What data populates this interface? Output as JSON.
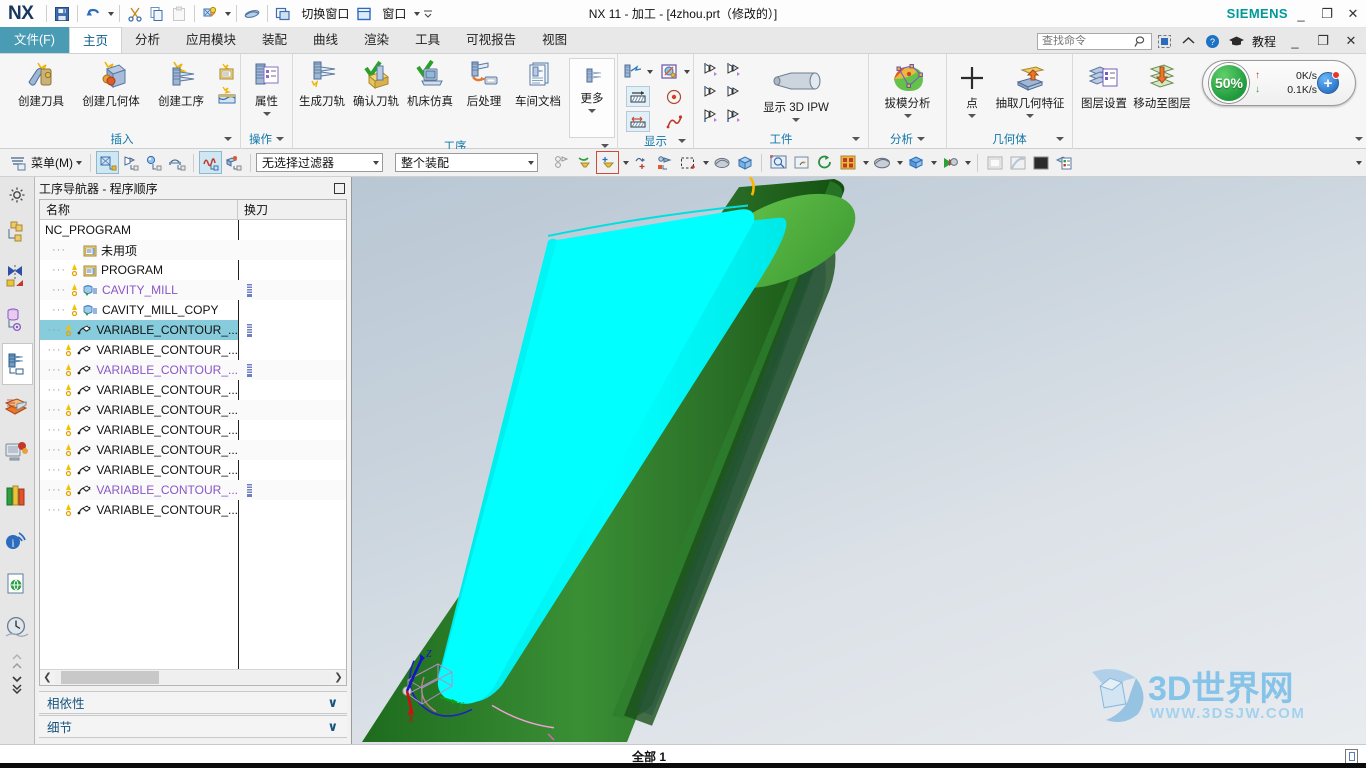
{
  "titlebar": {
    "logo": "NX",
    "title": "NX 11 - 加工 - [4zhou.prt（修改的）]",
    "brand": "SIEMENS",
    "quick_access": [
      {
        "name": "save",
        "label": "保存"
      },
      {
        "name": "undo",
        "label": "撤销"
      },
      {
        "name": "cut",
        "label": "剪切"
      },
      {
        "name": "copy",
        "label": "复制"
      },
      {
        "name": "paste",
        "label": "粘贴"
      },
      {
        "name": "redisplay",
        "label": "重新显示"
      },
      {
        "name": "undo-edit",
        "label": "取消"
      }
    ],
    "switch_window_label": "切换窗口",
    "window_label": "窗口",
    "minimize": "_",
    "restore": "❐",
    "close": "✕"
  },
  "tabs": [
    {
      "label": "文件(F)",
      "active": false,
      "file": true
    },
    {
      "label": "主页",
      "active": true
    },
    {
      "label": "分析",
      "active": false
    },
    {
      "label": "应用模块",
      "active": false
    },
    {
      "label": "装配",
      "active": false
    },
    {
      "label": "曲线",
      "active": false
    },
    {
      "label": "渲染",
      "active": false
    },
    {
      "label": "工具",
      "active": false
    },
    {
      "label": "可视报告",
      "active": false
    },
    {
      "label": "视图",
      "active": false
    }
  ],
  "tab_right": {
    "search_placeholder": "查找命令",
    "tutorial_label": "教程",
    "minimize": "_",
    "restore": "❐",
    "close": "✕"
  },
  "ribbon": {
    "groups": [
      {
        "name": "插入",
        "big": [
          {
            "label": "创建刀具",
            "icon": "create-tool-icon"
          },
          {
            "label": "创建几何体",
            "icon": "create-geometry-icon"
          },
          {
            "label": "创建工序",
            "icon": "create-operation-icon"
          }
        ],
        "small": [
          {
            "icon": "create-program-icon"
          },
          {
            "icon": "create-method-icon"
          }
        ]
      },
      {
        "name": "操作",
        "big": [
          {
            "label": "属性",
            "icon": "properties-icon",
            "dropdown": true
          }
        ]
      },
      {
        "name": "工序",
        "big": [
          {
            "label": "生成刀轨",
            "icon": "generate-toolpath-icon"
          },
          {
            "label": "确认刀轨",
            "icon": "verify-toolpath-icon"
          },
          {
            "label": "机床仿真",
            "icon": "machine-simulation-icon"
          },
          {
            "label": "后处理",
            "icon": "postprocess-icon"
          },
          {
            "label": "车间文档",
            "icon": "shop-documentation-icon"
          },
          {
            "label": "更多",
            "icon": "more-icon",
            "dropdown": true
          }
        ]
      },
      {
        "name": "显示",
        "small": [
          {
            "icon": "display-toolpath-icon",
            "dropdown": true
          },
          {
            "icon": "display-ipw-icon",
            "dropdown": true
          },
          {
            "icon": "cut-region-icon",
            "selected": true
          },
          {
            "icon": "point-display-icon"
          },
          {
            "icon": "cut-area-icon",
            "selected": true
          },
          {
            "icon": "curve-icon"
          }
        ]
      },
      {
        "name": "工件",
        "small": [
          {
            "icon": "workpiece-1-icon"
          },
          {
            "icon": "workpiece-2-icon"
          },
          {
            "icon": "workpiece-3-icon"
          },
          {
            "icon": "workpiece-4-icon"
          },
          {
            "icon": "workpiece-5-icon"
          },
          {
            "icon": "workpiece-6-icon"
          }
        ],
        "big": [
          {
            "label": "显示 3D IPW",
            "icon": "show-3d-ipw-icon",
            "dropdown": true
          }
        ]
      },
      {
        "name": "分析",
        "big": [
          {
            "label": "拔模分析",
            "icon": "draft-analysis-icon",
            "dropdown": true
          }
        ]
      },
      {
        "name": "几何体",
        "big": [
          {
            "label": "点",
            "icon": "point-icon",
            "dropdown": true
          },
          {
            "label": "抽取几何特征",
            "icon": "extract-geometry-icon",
            "dropdown": true
          }
        ]
      },
      {
        "name": "",
        "big": [
          {
            "label": "图层设置",
            "icon": "layer-settings-icon"
          },
          {
            "label": "移动至图层",
            "icon": "move-to-layer-icon"
          }
        ]
      }
    ]
  },
  "network_widget": {
    "percent": "50%",
    "up_rate": "0K/s",
    "down_rate": "0.1K/s",
    "up_arrow": "↑",
    "down_arrow": "↓",
    "badge": "+"
  },
  "toolbar2": {
    "menu_label": "菜单(M)",
    "selection_filter": "无选择过滤器",
    "assembly_scope": "整个装配",
    "buttons": [
      {
        "name": "select-face-icon",
        "selected": true
      },
      {
        "name": "select-edge-icon"
      },
      {
        "name": "select-body-icon"
      },
      {
        "name": "select-feature-icon"
      },
      {
        "name": "select-curve-icon",
        "selected": true
      },
      {
        "name": "select-component-icon"
      }
    ],
    "right_buttons": [
      {
        "name": "fit-view-icon"
      },
      {
        "name": "zoom-window-icon"
      },
      {
        "name": "pan-icon"
      },
      {
        "name": "rotate-icon"
      },
      {
        "name": "view-orientation-icon"
      },
      {
        "name": "shading-icon"
      },
      {
        "name": "render-style-icon"
      },
      {
        "name": "background-icon"
      },
      {
        "name": "layout-1-icon"
      },
      {
        "name": "layout-2-icon"
      },
      {
        "name": "layout-3-icon"
      },
      {
        "name": "layer-visible-icon"
      }
    ]
  },
  "resource_bar": [
    {
      "name": "assembly-navigator-icon",
      "active": false
    },
    {
      "name": "constraint-navigator-icon",
      "active": false
    },
    {
      "name": "part-navigator-icon",
      "active": false
    },
    {
      "name": "operation-navigator-icon",
      "active": true
    },
    {
      "name": "reuse-library-icon",
      "active": false
    },
    {
      "name": "web-browser-icon",
      "active": false
    },
    {
      "name": "history-icon",
      "active": false
    },
    {
      "name": "info-icon",
      "active": false
    },
    {
      "name": "html-help-icon",
      "active": false
    },
    {
      "name": "roles-icon",
      "active": false
    }
  ],
  "navigator": {
    "title": "工序导航器 - 程序顺序",
    "columns": [
      "名称",
      "换刀"
    ],
    "rows": [
      {
        "label": "NC_PROGRAM",
        "indent": 0,
        "icon": "none",
        "color": "black",
        "warn": false,
        "tool": false,
        "selected": false
      },
      {
        "label": "未用项",
        "indent": 1,
        "icon": "folder",
        "color": "black",
        "warn": false,
        "tool": false,
        "selected": false
      },
      {
        "label": "PROGRAM",
        "indent": 1,
        "icon": "folder",
        "color": "black",
        "warn": true,
        "tool": false,
        "selected": false
      },
      {
        "label": "CAVITY_MILL",
        "indent": 1,
        "icon": "mill",
        "color": "purple",
        "warn": true,
        "tool": true,
        "selected": false
      },
      {
        "label": "CAVITY_MILL_COPY",
        "indent": 1,
        "icon": "mill",
        "color": "black",
        "warn": true,
        "tool": false,
        "selected": false
      },
      {
        "label": "VARIABLE_CONTOUR_...",
        "indent": 1,
        "icon": "contour",
        "color": "black",
        "warn": true,
        "tool": true,
        "selected": true
      },
      {
        "label": "VARIABLE_CONTOUR_...",
        "indent": 1,
        "icon": "contour",
        "color": "black",
        "warn": true,
        "tool": false,
        "selected": false
      },
      {
        "label": "VARIABLE_CONTOUR_...",
        "indent": 1,
        "icon": "contour",
        "color": "purple",
        "warn": true,
        "tool": true,
        "selected": false
      },
      {
        "label": "VARIABLE_CONTOUR_...",
        "indent": 1,
        "icon": "contour",
        "color": "black",
        "warn": true,
        "tool": false,
        "selected": false
      },
      {
        "label": "VARIABLE_CONTOUR_...",
        "indent": 1,
        "icon": "contour",
        "color": "black",
        "warn": true,
        "tool": false,
        "selected": false
      },
      {
        "label": "VARIABLE_CONTOUR_...",
        "indent": 1,
        "icon": "contour",
        "color": "black",
        "warn": true,
        "tool": false,
        "selected": false
      },
      {
        "label": "VARIABLE_CONTOUR_...",
        "indent": 1,
        "icon": "contour",
        "color": "black",
        "warn": true,
        "tool": false,
        "selected": false
      },
      {
        "label": "VARIABLE_CONTOUR_...",
        "indent": 1,
        "icon": "contour",
        "color": "black",
        "warn": true,
        "tool": false,
        "selected": false
      },
      {
        "label": "VARIABLE_CONTOUR_...",
        "indent": 1,
        "icon": "contour",
        "color": "purple",
        "warn": true,
        "tool": true,
        "selected": false
      },
      {
        "label": "VARIABLE_CONTOUR_...",
        "indent": 1,
        "icon": "contour",
        "color": "black",
        "warn": true,
        "tool": false,
        "selected": false
      }
    ],
    "accordions": [
      {
        "label": "相依性",
        "chevron": "∨"
      },
      {
        "label": "细节",
        "chevron": "∨"
      }
    ]
  },
  "viewport": {
    "triad_labels": {
      "x": "X",
      "y": "Y",
      "z": "Z"
    },
    "watermark_title": "3D世界网",
    "watermark_url": "WWW.3DSJW.COM"
  },
  "statusbar": {
    "text": "全部 1"
  },
  "colors": {
    "accent": "#1277a8",
    "file_tab": "#4a9cb5",
    "selection": "#86ccdc",
    "purple_item": "#8a55c6",
    "siemens": "#009999",
    "model_cyan": "#00f0f0",
    "model_green": "#3fa63f"
  }
}
